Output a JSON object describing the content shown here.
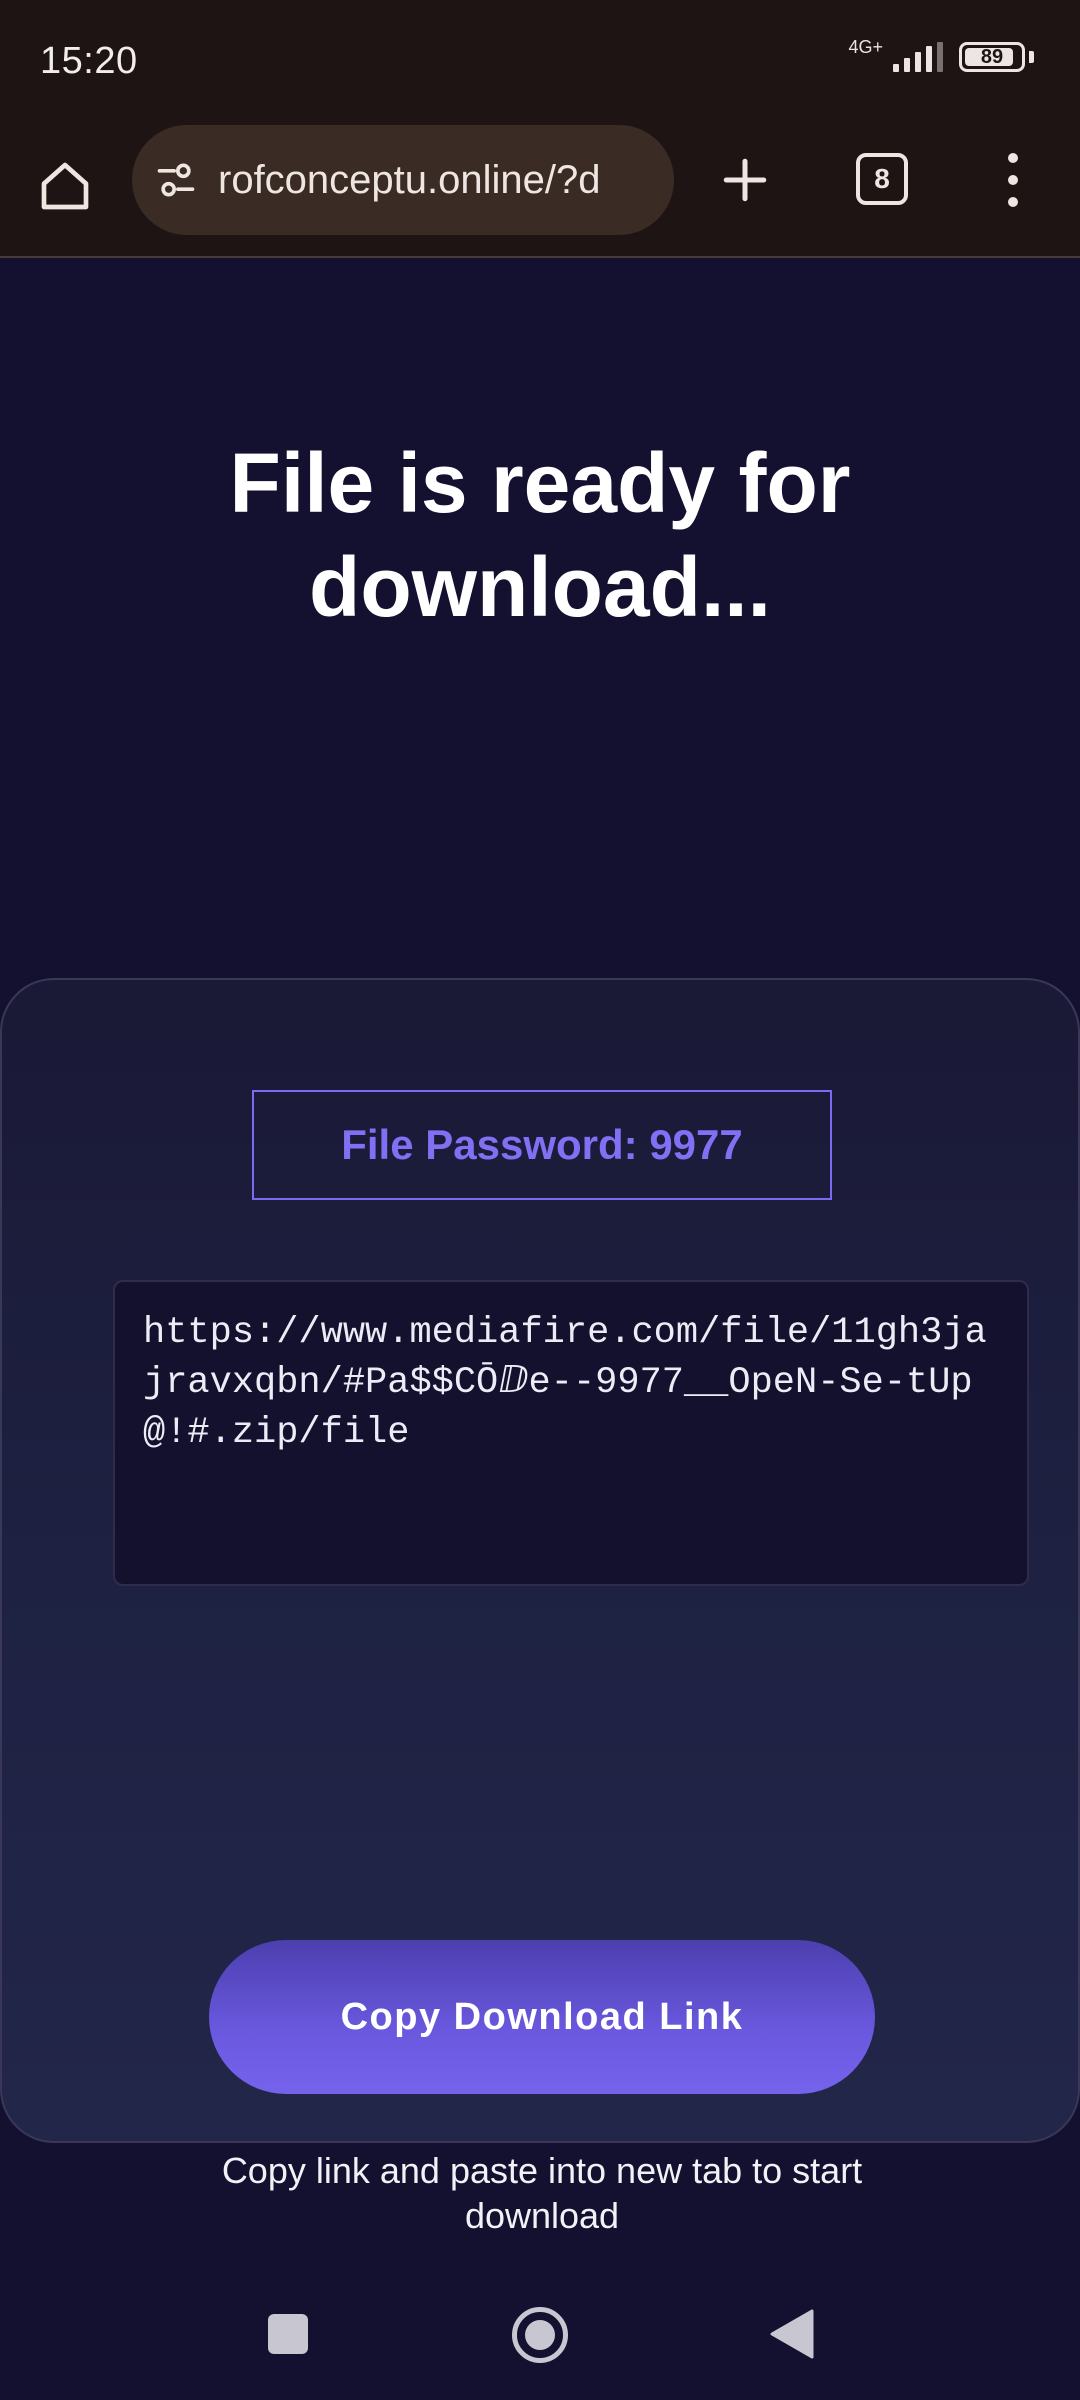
{
  "status_bar": {
    "time": "15:20",
    "network_type": "4G+",
    "battery_level": "89",
    "battery_fraction": 0.89,
    "signal_bars": 4
  },
  "browser": {
    "url": "rofconceptu.online/?d",
    "tab_count": "8",
    "icons": {
      "home": "home-icon",
      "site_settings": "tune-icon",
      "new_tab": "plus-icon",
      "tabs": "tab-switcher-icon",
      "menu": "more-vert-icon"
    }
  },
  "page": {
    "title": "File is ready for download...",
    "password_label": "File Password: 9977",
    "download_link": "https://www.mediafire.com/file/11gh3jajravxqbn/#Pa$$CŌⅅe--9977__OpeN-Se-tUp@!#.zip/file",
    "copy_button_label": "Copy Download Link",
    "hint": "Copy link and paste into new tab to start download"
  },
  "colors": {
    "page_bg": "#131030",
    "accent": "#7563ec",
    "password_text": "#8170f4",
    "browser_bg": "#1d1413"
  },
  "nav_bar": {
    "icons": [
      "recents-icon",
      "home-icon",
      "back-icon"
    ]
  }
}
